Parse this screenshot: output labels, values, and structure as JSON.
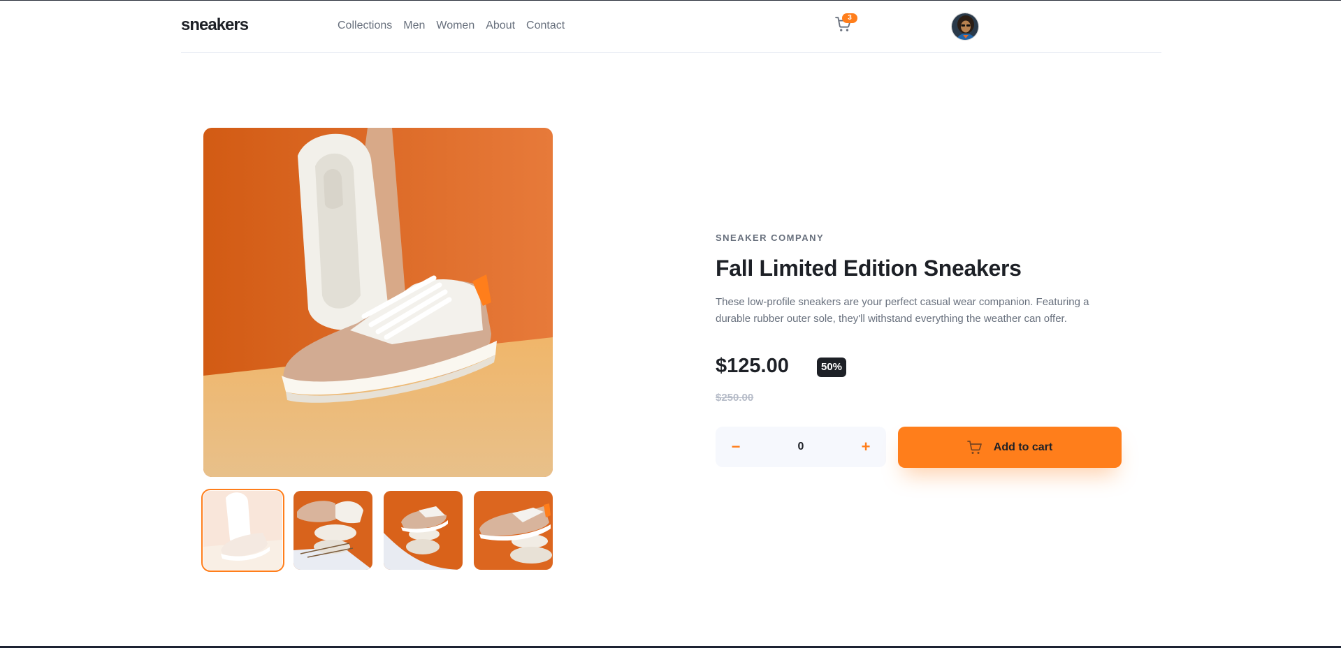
{
  "header": {
    "logo": "sneakers",
    "nav": [
      "Collections",
      "Men",
      "Women",
      "About",
      "Contact"
    ],
    "cart_count": "3"
  },
  "product": {
    "company": "SNEAKER COMPANY",
    "title": "Fall Limited Edition Sneakers",
    "description": "These low-profile sneakers are your perfect casual wear companion. Featuring a durable rubber outer sole, they'll withstand everything the weather can offer.",
    "price": "$125.00",
    "discount": "50%",
    "original_price": "$250.00",
    "quantity": "0",
    "minus_symbol": "−",
    "plus_symbol": "+",
    "add_to_cart_label": "Add to cart"
  },
  "colors": {
    "accent": "#ff7e1b",
    "text_dark": "#1d2026",
    "text_muted": "#68707d",
    "qty_background": "#f6f8fd"
  },
  "icons": {
    "cart": "cart-icon",
    "avatar": "avatar-image"
  }
}
